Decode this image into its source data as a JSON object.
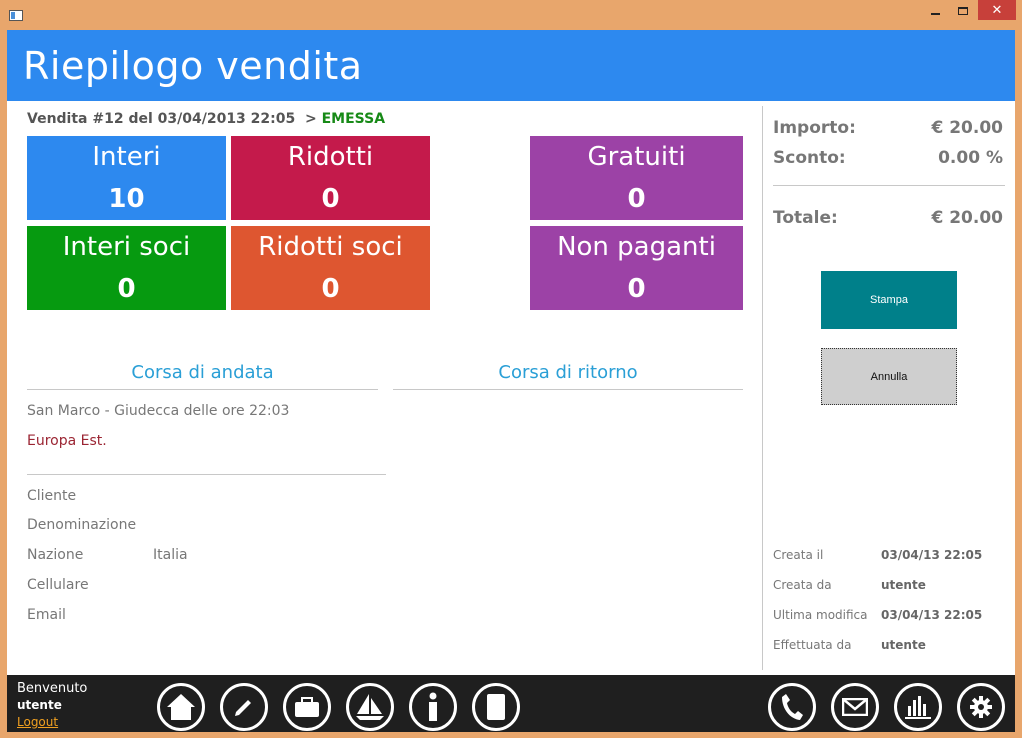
{
  "header": {
    "title": "Riepilogo vendita"
  },
  "sale": {
    "label": "Vendita #12 del 03/04/2013 22:05",
    "arrow": ">",
    "status": "EMESSA"
  },
  "tiles": {
    "interi": {
      "label": "Interi",
      "value": "10",
      "color": "#2d89ef"
    },
    "ridotti": {
      "label": "Ridotti",
      "value": "0",
      "color": "#c41a4b"
    },
    "gratuiti": {
      "label": "Gratuiti",
      "value": "0",
      "color": "#9c42a6"
    },
    "interi_soci": {
      "label": "Interi soci",
      "value": "0",
      "color": "#069a10"
    },
    "ridotti_soci": {
      "label": "Ridotti soci",
      "value": "0",
      "color": "#de5630"
    },
    "non_paganti": {
      "label": "Non paganti",
      "value": "0",
      "color": "#9c42a6"
    }
  },
  "trips": {
    "andata_title": "Corsa di andata",
    "ritorno_title": "Corsa di ritorno",
    "andata_route": "San Marco - Giudecca delle ore 22:03",
    "andata_operator": "Europa Est."
  },
  "customer": {
    "cliente_label": "Cliente",
    "denominazione_label": "Denominazione",
    "nazione_label": "Nazione",
    "nazione_value": "Italia",
    "cellulare_label": "Cellulare",
    "email_label": "Email"
  },
  "summary": {
    "importo_label": "Importo:",
    "importo_value": "€ 20.00",
    "sconto_label": "Sconto:",
    "sconto_value": "0.00 %",
    "totale_label": "Totale:",
    "totale_value": "€ 20.00"
  },
  "actions": {
    "print_label": "Stampa",
    "cancel_label": "Annulla"
  },
  "meta": {
    "created_at_label": "Creata il",
    "created_at_value": "03/04/13 22:05",
    "created_by_label": "Creata da",
    "created_by_value": "utente",
    "modified_label": "Ultima modifica",
    "modified_value": "03/04/13 22:05",
    "done_by_label": "Effettuata da",
    "done_by_value": "utente"
  },
  "footer": {
    "welcome": "Benvenuto",
    "username": "utente",
    "logout": "Logout",
    "nav_icons": [
      "home-icon",
      "pencil-icon",
      "briefcase-icon",
      "sailboat-icon",
      "info-icon",
      "document-icon",
      "phone-icon",
      "mail-icon",
      "chart-icon",
      "gear-icon"
    ]
  }
}
